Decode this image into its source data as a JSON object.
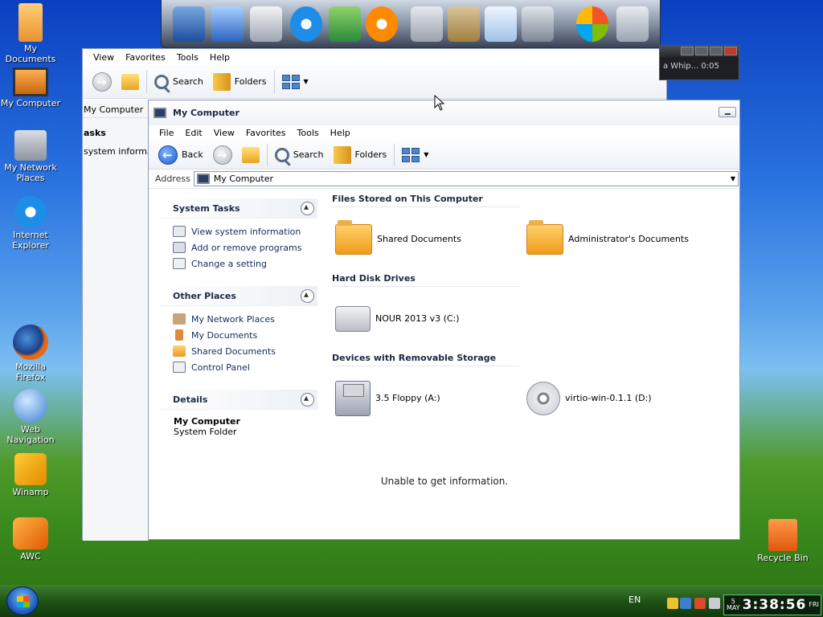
{
  "desktop": {
    "icons": [
      {
        "label": "My Documents"
      },
      {
        "label": "My Computer"
      },
      {
        "label": "My Network Places"
      },
      {
        "label": "Internet Explorer"
      },
      {
        "label": "Mozilla Firefox"
      },
      {
        "label": "Web Navigation"
      },
      {
        "label": "Winamp"
      },
      {
        "label": "AWC"
      },
      {
        "label": "Recycle Bin"
      }
    ]
  },
  "back_window": {
    "menu": [
      "View",
      "Favorites",
      "Tools",
      "Help"
    ],
    "toolbar": {
      "search": "Search",
      "folders": "Folders"
    },
    "side_title": "My Computer",
    "side_items": [
      "asks",
      "system informa"
    ]
  },
  "player": {
    "text": "a Whip... 0:05"
  },
  "window": {
    "title": "My Computer",
    "menu": [
      "File",
      "Edit",
      "View",
      "Favorites",
      "Tools",
      "Help"
    ],
    "toolbar": {
      "back": "Back",
      "search": "Search",
      "folders": "Folders"
    },
    "address": {
      "label": "Address",
      "value": "My Computer"
    },
    "panels": {
      "system_tasks": {
        "title": "System Tasks",
        "items": [
          "View system information",
          "Add or remove programs",
          "Change a setting"
        ]
      },
      "other_places": {
        "title": "Other Places",
        "items": [
          "My Network Places",
          "My Documents",
          "Shared Documents",
          "Control Panel"
        ]
      },
      "details": {
        "title": "Details",
        "name": "My Computer",
        "type": "System Folder"
      }
    },
    "groups": {
      "files": {
        "title": "Files Stored on This Computer",
        "items": [
          "Shared Documents",
          "Administrator's Documents"
        ]
      },
      "hdd": {
        "title": "Hard Disk Drives",
        "items": [
          "NOUR 2013 v3 (C:)"
        ]
      },
      "removable": {
        "title": "Devices with Removable Storage",
        "items": [
          "3.5 Floppy (A:)",
          "virtio-win-0.1.1 (D:)"
        ]
      }
    },
    "message": "Unable to get information."
  },
  "taskbar": {
    "lang": "EN",
    "clock": {
      "day": "5",
      "month": "MAY",
      "weekday": "FRI",
      "time": "3:38:56"
    }
  }
}
